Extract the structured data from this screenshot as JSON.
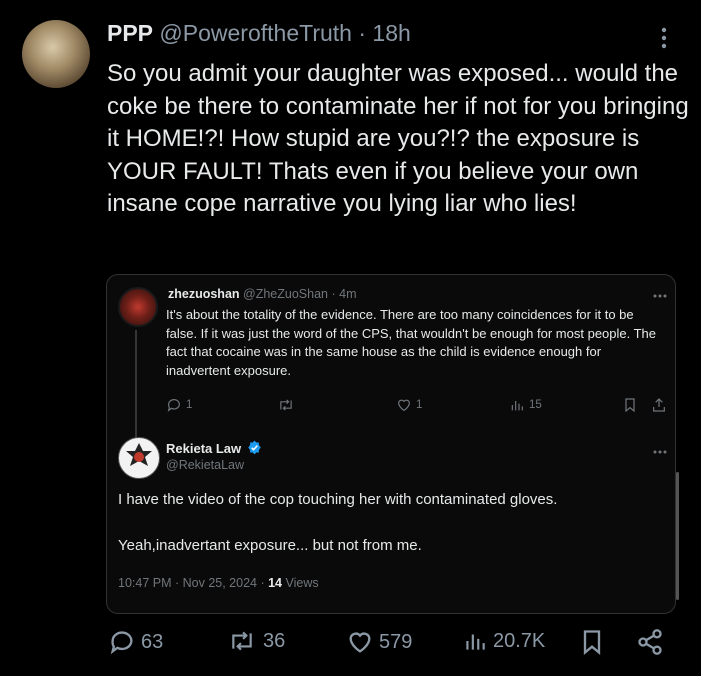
{
  "tweet": {
    "display_name": "PPP",
    "handle": "@PoweroftheTruth",
    "time": "18h",
    "dot": "·",
    "text": "So you admit your daughter was exposed... would the coke be there to contaminate her if not for you bringing it HOME!?! How stupid are you?!? the exposure is YOUR FAULT! Thats even if you believe your own insane cope narrative you lying liar who lies!",
    "stats": {
      "replies": "63",
      "reposts": "36",
      "likes": "579",
      "views": "20.7K"
    }
  },
  "quoted": {
    "post": {
      "display_name": "zhezuoshan",
      "handle": "@ZheZuoShan",
      "time": "4m",
      "text": "It's about the totality of the evidence. There are too many coincidences for it to be false. If it was just the word of the CPS, that wouldn't be enough for most people. The fact that cocaine was in the same house as the child is evidence enough for inadvertent exposure.",
      "stats": {
        "replies": "1",
        "reposts": "",
        "likes": "1",
        "views": "15"
      }
    },
    "reply": {
      "display_name": "Rekieta Law",
      "handle": "@RekietaLaw",
      "line1": "I have the video of the cop touching her with contaminated gloves.",
      "line2": "Yeah,inadvertant exposure... but not from me.",
      "timestamp": "10:47 PM · Nov 25, 2024 · ",
      "views_count": "14",
      "views_label": " Views"
    }
  },
  "colors": {
    "background": "#000000",
    "text": "#e7e9ea",
    "muted": "#8b98a5",
    "verified": "#1d9bf0"
  }
}
